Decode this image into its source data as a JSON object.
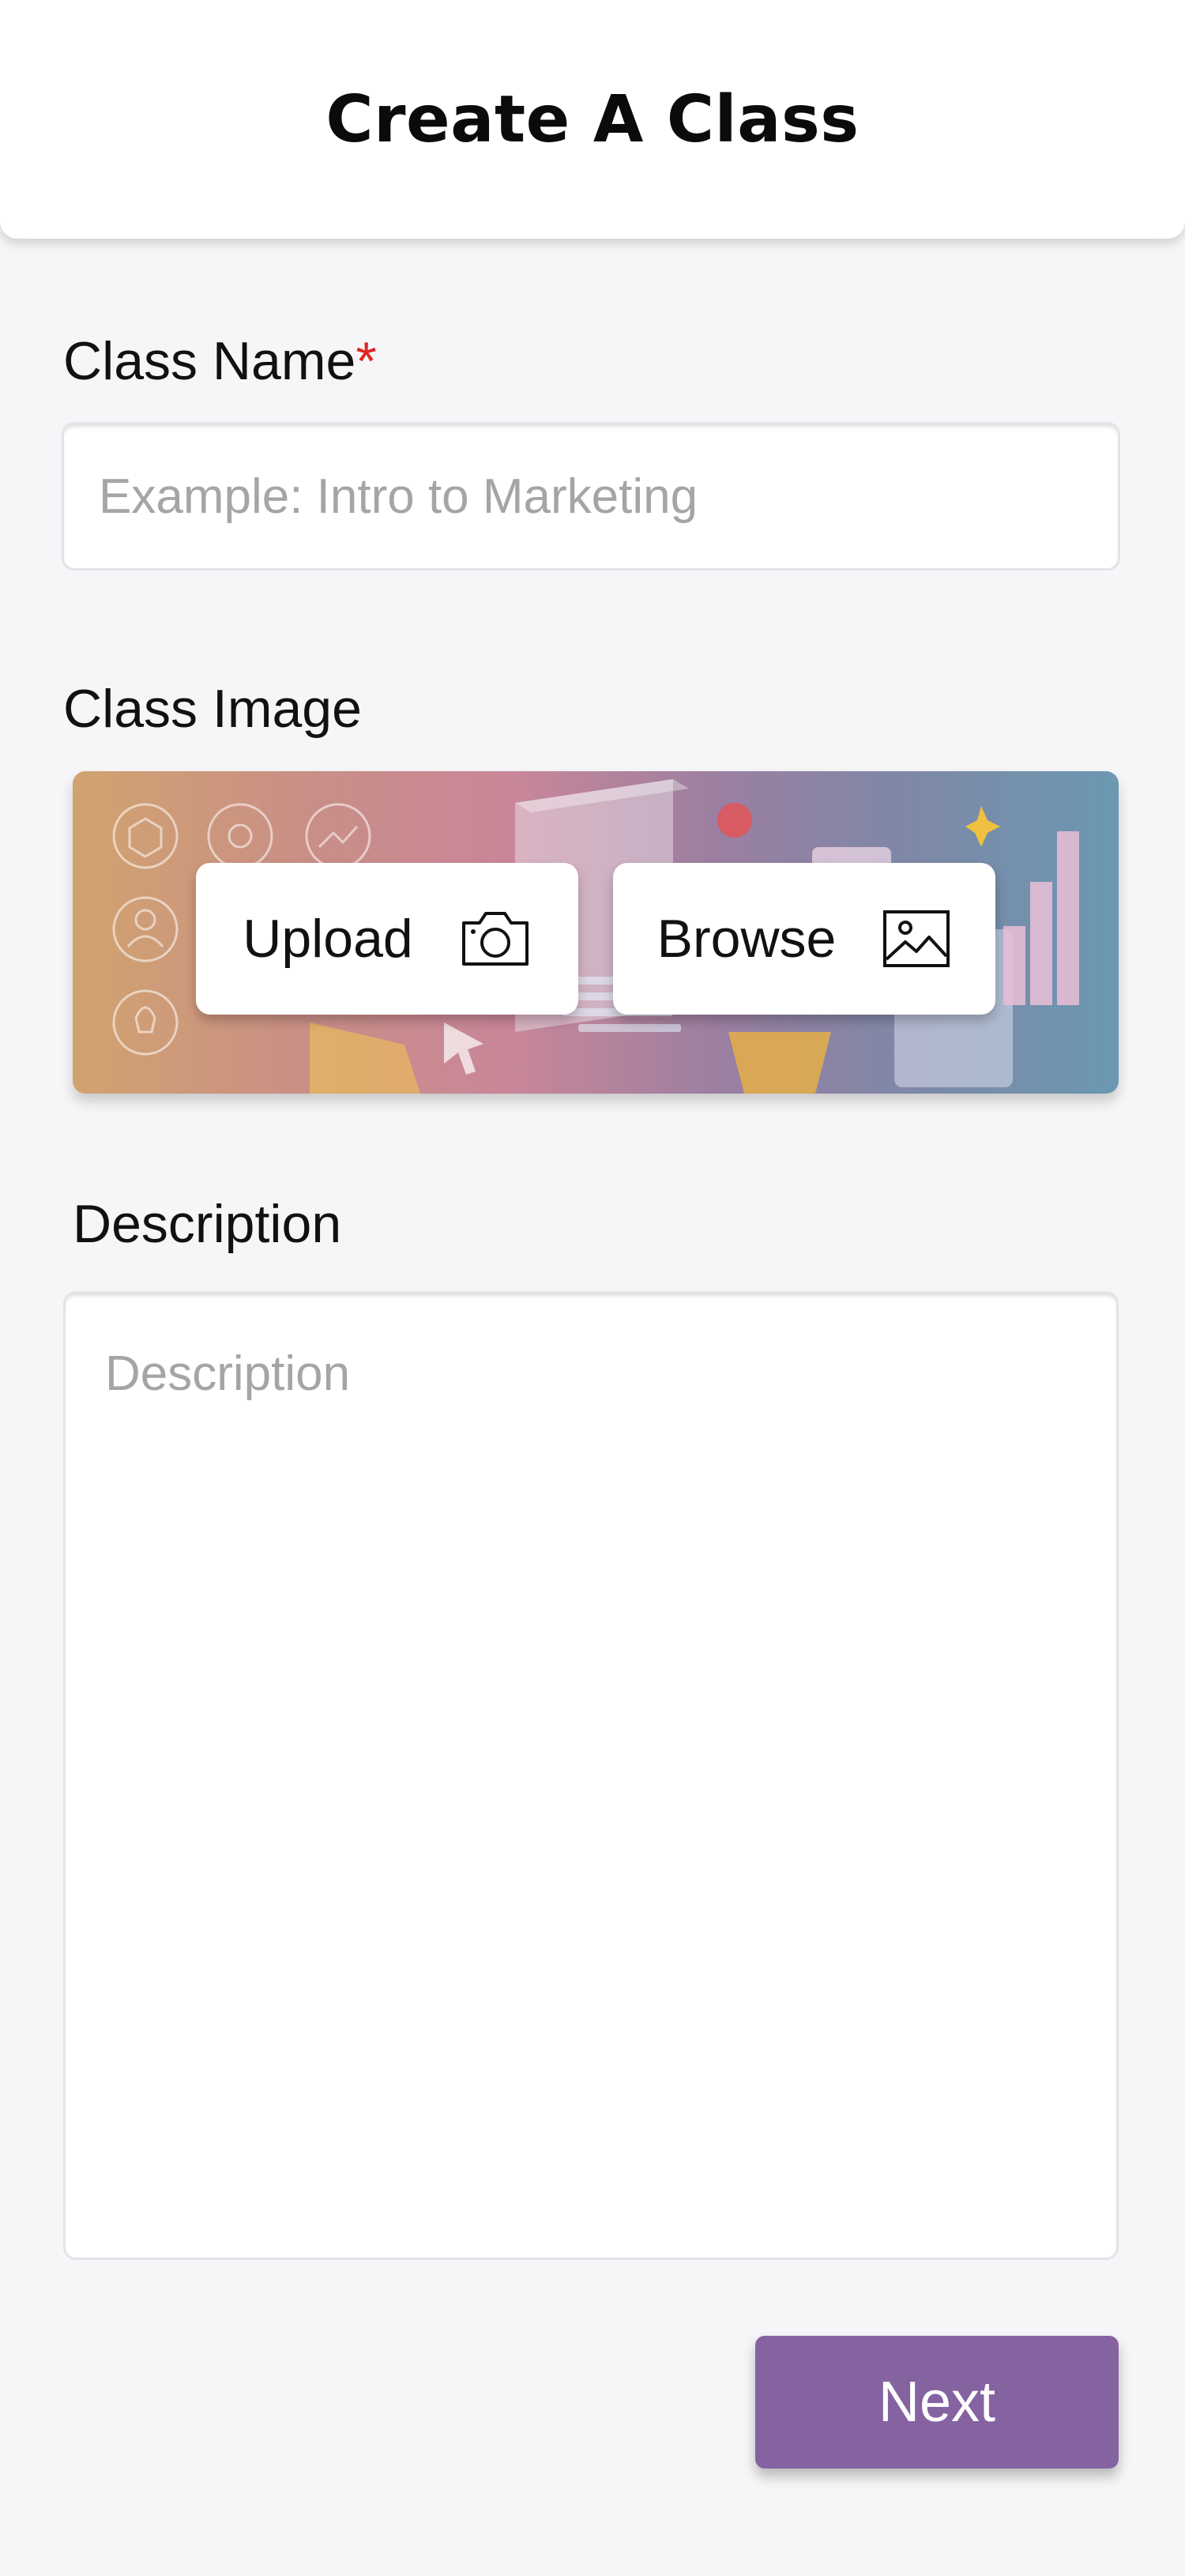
{
  "header": {
    "title": "Create A Class"
  },
  "form": {
    "class_name": {
      "label": "Class Name",
      "required_mark": "*",
      "placeholder": "Example: Intro to Marketing",
      "value": ""
    },
    "class_image": {
      "label": "Class Image",
      "upload_label": "Upload",
      "upload_icon": "camera-icon",
      "browse_label": "Browse",
      "browse_icon": "image-icon"
    },
    "description": {
      "label": "Description",
      "placeholder": "Description",
      "value": ""
    }
  },
  "actions": {
    "next_label": "Next"
  },
  "colors": {
    "accent": "#8563a1",
    "required": "#e02424",
    "background": "#f6f6f8",
    "placeholder": "#a5a5a5"
  }
}
